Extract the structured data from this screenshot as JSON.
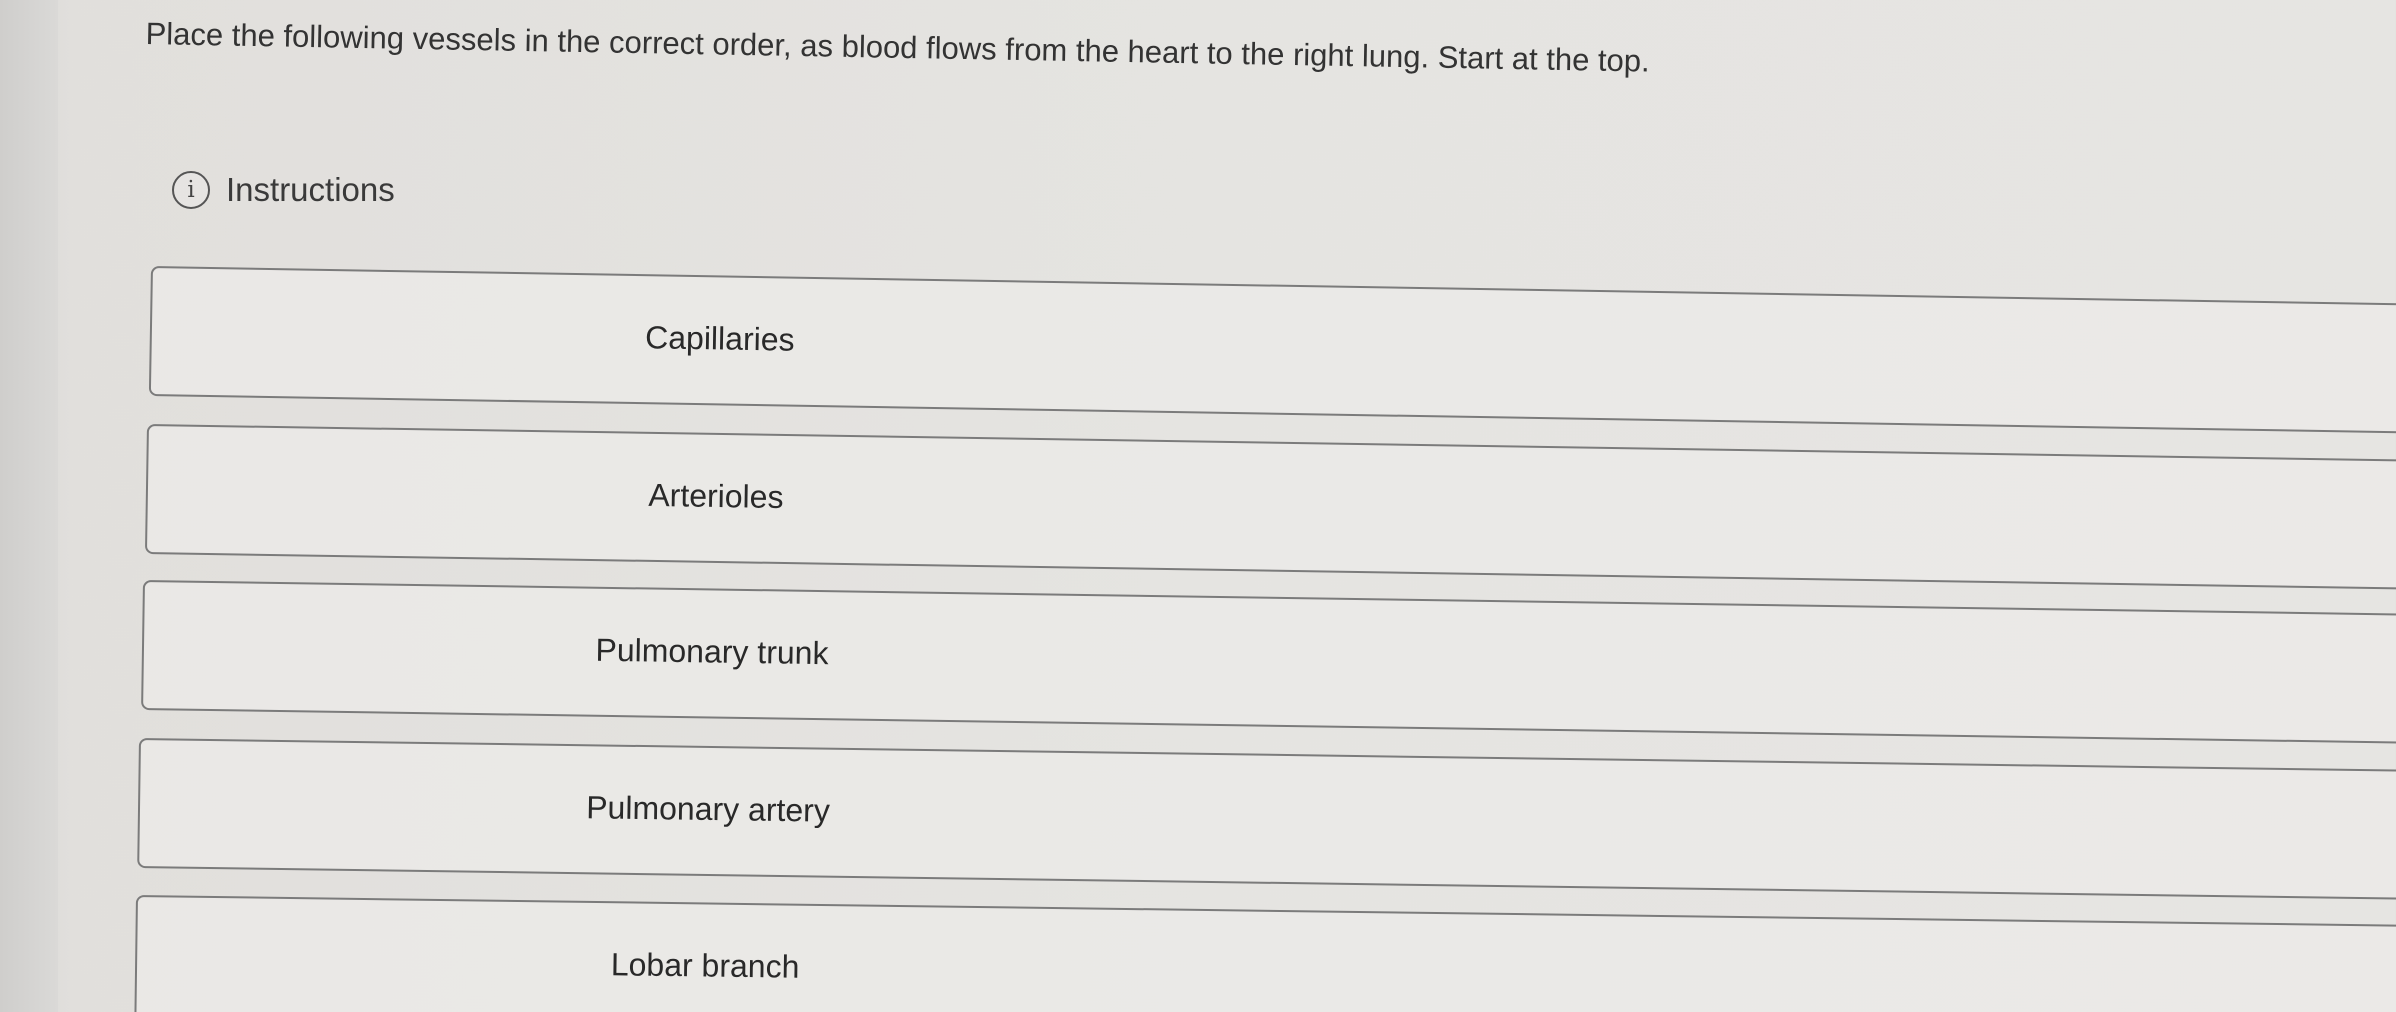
{
  "question": {
    "prompt": "Place the following vessels in the correct order, as blood flows from the heart to the right lung. Start at the top."
  },
  "instructions": {
    "icon": "info-icon",
    "icon_glyph": "i",
    "label": "Instructions"
  },
  "order_items": [
    {
      "label": "Capillaries"
    },
    {
      "label": "Arterioles"
    },
    {
      "label": "Pulmonary trunk"
    },
    {
      "label": "Pulmonary artery"
    },
    {
      "label": "Lobar branch"
    }
  ]
}
